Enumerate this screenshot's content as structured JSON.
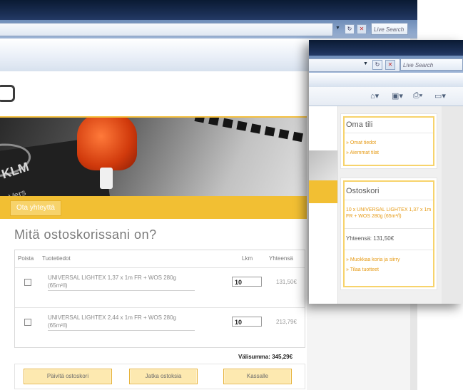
{
  "browser": {
    "search_placeholder": "Live Search",
    "nav_icons": [
      "dropdown-arrow-icon",
      "refresh-icon",
      "stop-icon"
    ],
    "refresh_glyph": "↻",
    "stop_glyph": "✕",
    "dropdown_glyph": "▼"
  },
  "back_page": {
    "return_link": "Ota yhteyttä",
    "cart_title": "Mitä ostoskorissani on?",
    "table": {
      "headers": {
        "remove": "Poista",
        "product": "Tuotetiedot",
        "qty": "Lkm",
        "total": "Yhteensä"
      },
      "rows": [
        {
          "product": "UNIVERSAL LIGHTEX 1,37 x 1m FR + WOS 280g (65m²/l)",
          "qty": "10",
          "price": "131,50€"
        },
        {
          "product": "UNIVERSAL LIGHTEX 2,44 x 1m FR + WOS 280g (65m²/l)",
          "qty": "10",
          "price": "213,79€"
        }
      ]
    },
    "subtotal": "Välisumma: 345,29€",
    "buttons": {
      "empty": "Päivitä ostoskori",
      "continue": "Jatka ostoksia",
      "checkout": "Kassalle"
    }
  },
  "front_page": {
    "account": {
      "title": "Oma tili",
      "links": [
        "» Omat tiedot",
        "» Aiemmat tilat"
      ]
    },
    "cart": {
      "title": "Ostoskori",
      "item": "10 x UNIVERSAL LIGHTEX 1,37 x 1m FR + WOS 280g (65m²/l)",
      "total": "Yhteensä: 131,50€",
      "links": [
        "» Muokkaa koria ja siirry",
        "» Tilaa tuotteet"
      ]
    }
  },
  "colors": {
    "accent_yellow": "#f2bf33",
    "link_orange": "#e69a14",
    "titlebar": "#0a1a33"
  }
}
